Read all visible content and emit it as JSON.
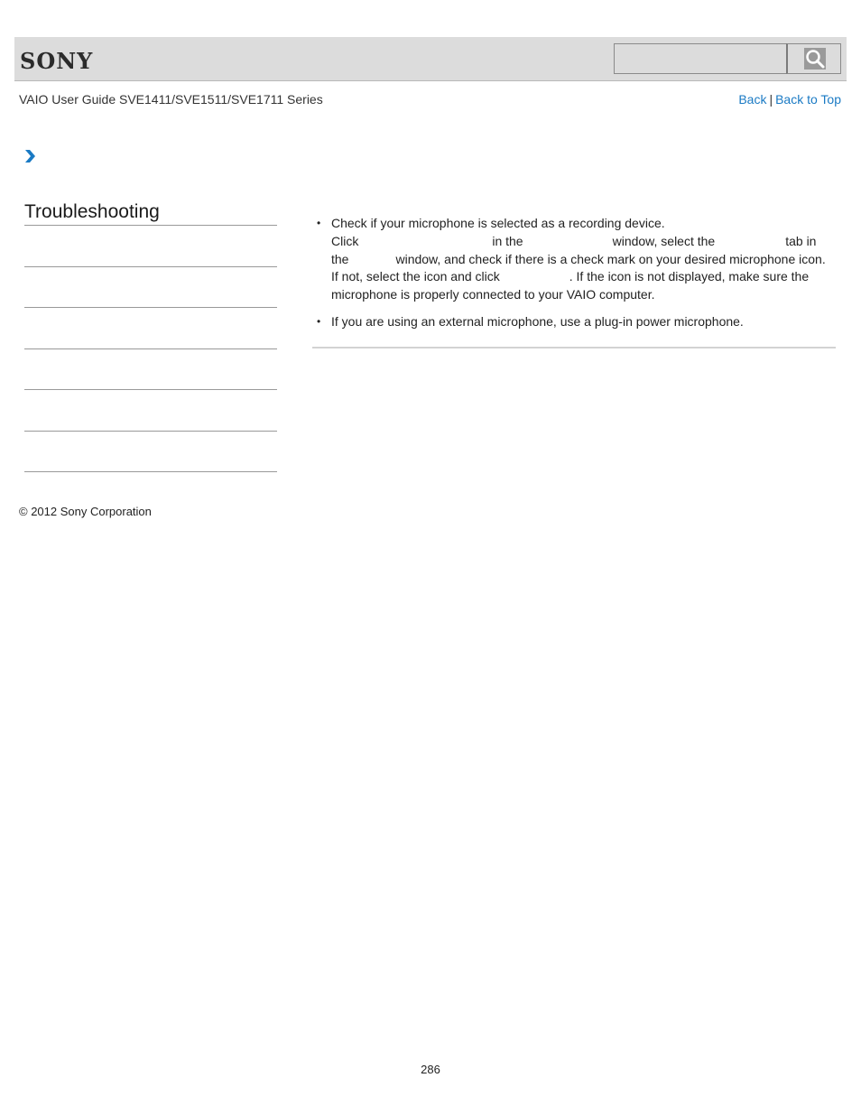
{
  "header": {
    "logo": "SONY",
    "search": {
      "value": "",
      "placeholder": ""
    },
    "search_icon": "search-icon"
  },
  "nav": {
    "guide_title": "VAIO User Guide SVE1411/SVE1511/SVE1711 Series",
    "back_label": "Back",
    "separator": "|",
    "back_to_top_label": "Back to Top"
  },
  "breadcrumb": {
    "icon": "chevron-right-icon",
    "accent": "#1a7ac4"
  },
  "sidebar": {
    "title": "Troubleshooting",
    "items": [
      "",
      "",
      "",
      "",
      "",
      ""
    ]
  },
  "content": {
    "bullet_glyph": "•",
    "items": [
      {
        "first_line": "Check if your microphone is selected as a recording device.",
        "line2_a": "Click",
        "line2_b": "in the",
        "line2_c": "window, select the",
        "line2_d": "tab in",
        "line3_a": "the",
        "line3_b": "window, and check if there is a check mark on your desired microphone icon.",
        "line4_a": "If not, select the icon and click",
        "line4_b": ". If the icon is not displayed, make sure the",
        "line5": "microphone is properly connected to your VAIO computer."
      },
      {
        "first_line": "If you are using an external microphone, use a plug-in power microphone."
      }
    ]
  },
  "footer": {
    "copyright": "© 2012 Sony Corporation",
    "page_number": "286"
  }
}
